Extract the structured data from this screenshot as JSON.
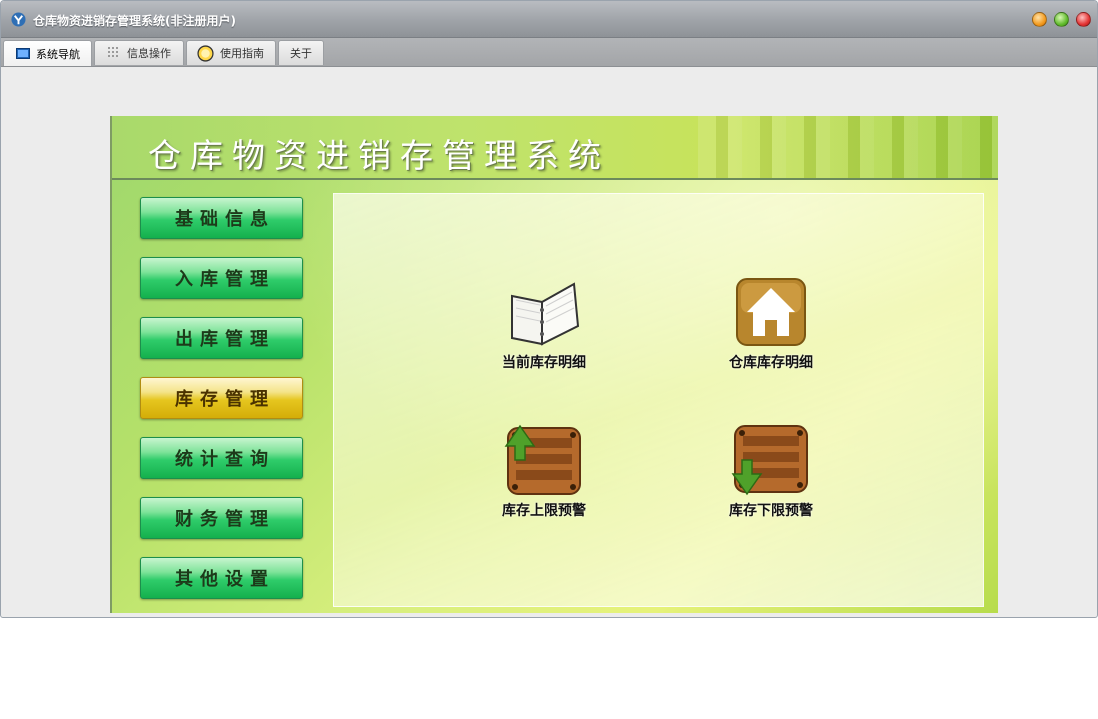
{
  "window": {
    "title": "仓库物资进销存管理系统(非注册用户)",
    "icons": [
      "app-logo-icon",
      "minimize-icon",
      "maximize-icon",
      "close-icon"
    ]
  },
  "tabs": [
    {
      "label": "系统导航",
      "icon": "monitor-icon",
      "active": true
    },
    {
      "label": "信息操作",
      "icon": "grid-icon",
      "active": false
    },
    {
      "label": "使用指南",
      "icon": "help-circle-icon",
      "active": false
    },
    {
      "label": "关于",
      "icon": "",
      "active": false
    }
  ],
  "header": {
    "title": "仓库物资进销存管理系统"
  },
  "menu": [
    {
      "label": "基础信息",
      "selected": false
    },
    {
      "label": "入库管理",
      "selected": false
    },
    {
      "label": "出库管理",
      "selected": false
    },
    {
      "label": "库存管理",
      "selected": true
    },
    {
      "label": "统计查询",
      "selected": false
    },
    {
      "label": "财务管理",
      "selected": false
    },
    {
      "label": "其他设置",
      "selected": false
    }
  ],
  "items": [
    {
      "label": "当前库存明细",
      "icon": "open-book-icon"
    },
    {
      "label": "仓库库存明细",
      "icon": "house-icon"
    },
    {
      "label": "库存上限预警",
      "icon": "crate-up-arrow-icon"
    },
    {
      "label": "库存下限预警",
      "icon": "crate-down-arrow-icon"
    }
  ],
  "colors": {
    "menu_green": "#2fcc6a",
    "menu_selected_gold": "#e6c61f",
    "panel_green": "#b8e26a"
  }
}
